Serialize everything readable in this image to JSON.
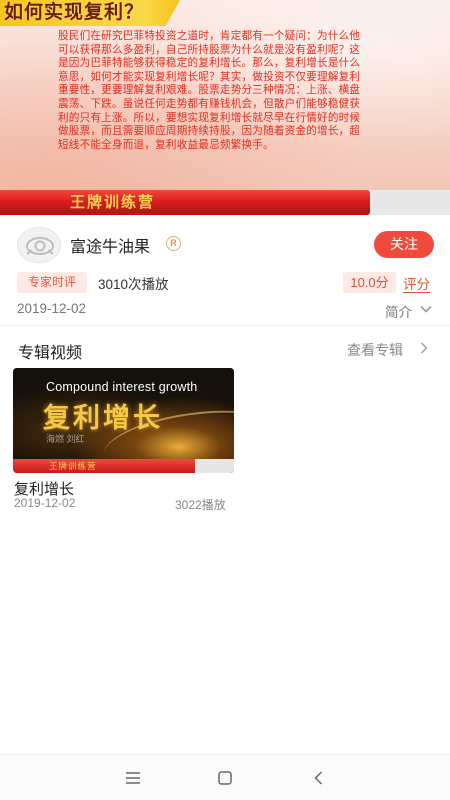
{
  "hero": {
    "title": "如何实现复利？",
    "body": "股民们在研究巴菲特投资之道时，肯定都有一个疑问：为什么他可以获得那么多盈利，自己所持股票为什么就是没有盈利呢？这是因为巴菲特能够获得稳定的复利增长。那么，复利增长是什么意思，如何才能实现复利增长呢？其实，做投资不仅要理解复利重要性，更要理解复利艰难。股票走势分三种情况：上涨、横盘震荡、下跌。虽说任何走势都有赚钱机会，但散户们能够稳健获利的只有上涨。所以，要想实现复利增长就尽早在行情好的时候做股票，而且需要顺应周期持续持股，因为随着资金的增长，超短线不能全身而退，复利收益最忌频繁换手。",
    "ribbon": "王牌训练营"
  },
  "author": {
    "name": "富途牛油果",
    "badge": "R",
    "follow_label": "关注"
  },
  "meta": {
    "tag": "专家时评",
    "plays": "3010次播放",
    "score": "10.0分",
    "rate_label": "评分",
    "date": "2019-12-02",
    "intro_label": "简介"
  },
  "album": {
    "title": "专辑视频",
    "view_label": "查看专辑"
  },
  "video": {
    "thumb_en": "Compound interest growth",
    "thumb_cn": "复利增长",
    "thumb_sub": "海燃     刘红",
    "thumb_ribbon": "王牌训练营",
    "title": "复利增长",
    "date": "2019-12-02",
    "plays": "3022播放"
  },
  "icons": {
    "avatar": "eye-logo-icon",
    "intro": "chevron-down-icon",
    "album": "chevron-right-icon",
    "nav_menu": "menu-icon",
    "nav_home": "home-square-icon",
    "nav_back": "back-icon"
  },
  "colors": {
    "accent": "#ef4a3c",
    "tag_bg": "#fdeae4",
    "gold": "#f5c845"
  }
}
